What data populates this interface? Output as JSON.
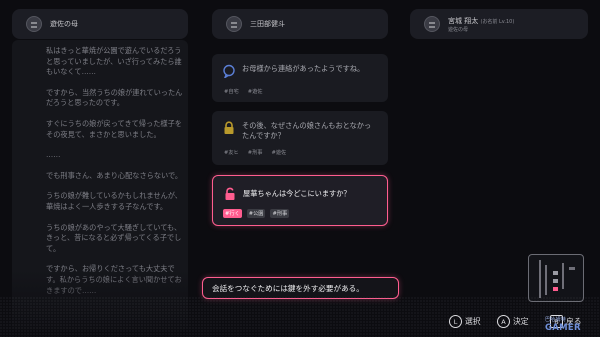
{
  "columns": [
    {
      "sub": "",
      "name": "遊佐の母"
    },
    {
      "sub": "",
      "name": "三田部健斗"
    },
    {
      "sub": "(お名前 Lv.10)",
      "name": "宮城 翔太"
    }
  ],
  "third_column_role": "遊佐の母",
  "history": [
    "私はきっと華焼が公園で遊んでいるだろうと思っていましたが、いざ行ってみたら誰もいなくて……",
    "ですから、当然うちの娘が連れていったんだろうと思ったのです。",
    "すぐにうちの娘が戻ってきて帰った様子をその夜見て、まさかと思いました。",
    "……",
    "でも刑事さん、あまり心配なさらないで。",
    "うちの娘が難しているかもしれませんが、華焼はよく一人歩きする子なんです。",
    "うちの娘があのやって大騒ぎしていても、きっと、昔になると必ず帰ってくる子でして。",
    "ですから、お帰りくださっても大丈夫です。私からうちの娘によく言い聞かせておきますので……"
  ],
  "cards": [
    {
      "question": "お母様から連絡があったようですね。",
      "tags": [
        "#自宅",
        "#遊佐"
      ],
      "state": "done"
    },
    {
      "question": "その後、なぜさんの娘さんもおとなかったんですか？",
      "tags": [
        "#友ヒ",
        "#刑事",
        "#遊佐"
      ],
      "state": "locked"
    },
    {
      "question": "屋華ちゃんは今どこにいますか？",
      "tags": [
        "#行く",
        "#公園",
        "#刑事"
      ],
      "state": "active"
    }
  ],
  "hint": "会話をつなぐためには鍵を外す必要がある。",
  "controls": {
    "select_key": "L",
    "select_label": "選択",
    "confirm_key": "A",
    "confirm_label": "決定",
    "back_key": "B",
    "back_label": "戻る"
  },
  "watermark": {
    "top": "巴哈姆特",
    "main": "GAMER"
  },
  "colors": {
    "accent": "#ff5d8f",
    "panel": "#1a1b21",
    "background": "#0c0c10"
  }
}
